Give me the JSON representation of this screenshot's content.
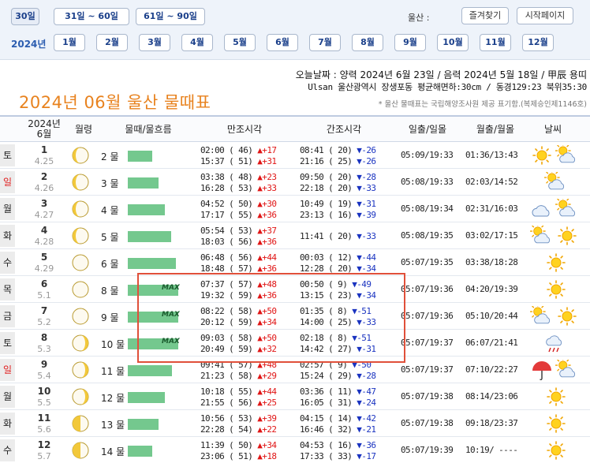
{
  "nav": {
    "range_buttons": [
      "30일",
      "31일 ~ 60일",
      "61일 ~ 90일"
    ],
    "region_label": "울산 :",
    "favorite_button": "즐겨찾기",
    "homepage_button": "시작페이지",
    "year": "2024년",
    "months": [
      "1월",
      "2월",
      "3월",
      "4월",
      "5월",
      "6월",
      "7월",
      "8월",
      "9월",
      "10월",
      "11월",
      "12월"
    ]
  },
  "info": {
    "line1": "오늘날짜 : 양력 2024년 6월 23일 / 음력 2024년 5월 18일 / 甲辰 용띠",
    "line2": "Ulsan 울산광역시 장생포동 평균해면하:30cm / 동경129:23 북위35:30",
    "title": "2024년 06월 울산 물때표",
    "note": "* 울산 물때표는 국립해양조사원 제공 표기함.(복제승인제1146호)"
  },
  "table": {
    "headers": {
      "date": "2024년\n6월",
      "moon_age": "월령",
      "tide": "물때/물흐름",
      "high": "만조시각",
      "low": "간조시각",
      "sun": "일출/일몰",
      "moonrise": "월출/월몰",
      "weather": "날씨"
    },
    "rows": [
      {
        "dow": "토",
        "red": false,
        "day": "1",
        "lunar": "4.25",
        "moon": "waning-crescent",
        "mul": "2 물",
        "bar": 0.4,
        "max": "",
        "h1": "02:00 ( 46)",
        "h1d": "▲+17",
        "h2": "15:37 ( 51)",
        "h2d": "▲+31",
        "l1": "08:41 ( 20)",
        "l1d": "▼-26",
        "l2": "21:16 ( 25)",
        "l2d": "▼-26",
        "sun": "05:09/19:33",
        "moonrise": "01:36/13:43",
        "weather": [
          "sun",
          "sun-cloud"
        ]
      },
      {
        "dow": "일",
        "red": true,
        "day": "2",
        "lunar": "4.26",
        "moon": "waning-crescent",
        "mul": "3 물",
        "bar": 0.5,
        "max": "",
        "h1": "03:38 ( 48)",
        "h1d": "▲+23",
        "h2": "16:28 ( 53)",
        "h2d": "▲+33",
        "l1": "09:50 ( 20)",
        "l1d": "▼-28",
        "l2": "22:18 ( 20)",
        "l2d": "▼-33",
        "sun": "05:08/19:33",
        "moonrise": "02:03/14:52",
        "weather": [
          "sun-cloud"
        ]
      },
      {
        "dow": "월",
        "red": false,
        "day": "3",
        "lunar": "4.27",
        "moon": "waning-crescent",
        "mul": "4 물",
        "bar": 0.6,
        "max": "",
        "h1": "04:52 ( 50)",
        "h1d": "▲+30",
        "h2": "17:17 ( 55)",
        "h2d": "▲+36",
        "l1": "10:49 ( 19)",
        "l1d": "▼-31",
        "l2": "23:13 ( 16)",
        "l2d": "▼-39",
        "sun": "05:08/19:34",
        "moonrise": "02:31/16:03",
        "weather": [
          "cloud",
          "sun-cloud"
        ]
      },
      {
        "dow": "화",
        "red": false,
        "day": "4",
        "lunar": "4.28",
        "moon": "waning-crescent",
        "mul": "5 물",
        "bar": 0.7,
        "max": "",
        "h1": "05:54 ( 53)",
        "h1d": "▲+37",
        "h2": "18:03 ( 56)",
        "h2d": "▲+36",
        "l1": "11:41 ( 20)",
        "l1d": "▼-33",
        "l2": "",
        "l2d": "",
        "sun": "05:08/19:35",
        "moonrise": "03:02/17:15",
        "weather": [
          "sun-cloud",
          "sun"
        ]
      },
      {
        "dow": "수",
        "red": false,
        "day": "5",
        "lunar": "4.29",
        "moon": "new",
        "mul": "6 물",
        "bar": 0.78,
        "max": "",
        "h1": "06:48 ( 56)",
        "h1d": "▲+44",
        "h2": "18:48 ( 57)",
        "h2d": "▲+36",
        "l1": "00:03 ( 12)",
        "l1d": "▼-44",
        "l2": "12:28 ( 20)",
        "l2d": "▼-34",
        "sun": "05:07/19:35",
        "moonrise": "03:38/18:28",
        "weather": [
          "sun"
        ]
      },
      {
        "dow": "목",
        "red": false,
        "day": "6",
        "lunar": "5.1",
        "moon": "new",
        "mul": "8 물",
        "bar": 0.82,
        "max": "MAX",
        "h1": "07:37 ( 57)",
        "h1d": "▲+48",
        "h2": "19:32 ( 59)",
        "h2d": "▲+36",
        "l1": "00:50 (  9)",
        "l1d": "▼-49",
        "l2": "13:15 ( 23)",
        "l2d": "▼-34",
        "sun": "05:07/19:36",
        "moonrise": "04:20/19:39",
        "weather": [
          "sun"
        ]
      },
      {
        "dow": "금",
        "red": false,
        "day": "7",
        "lunar": "5.2",
        "moon": "new",
        "mul": "9 물",
        "bar": 0.82,
        "max": "MAX",
        "h1": "08:22 ( 58)",
        "h1d": "▲+50",
        "h2": "20:12 ( 59)",
        "h2d": "▲+34",
        "l1": "01:35 (  8)",
        "l1d": "▼-51",
        "l2": "14:00 ( 25)",
        "l2d": "▼-33",
        "sun": "05:07/19:36",
        "moonrise": "05:10/20:44",
        "weather": [
          "sun-cloud",
          "sun"
        ]
      },
      {
        "dow": "토",
        "red": false,
        "day": "8",
        "lunar": "5.3",
        "moon": "waxing-crescent",
        "mul": "10 물",
        "bar": 0.82,
        "max": "MAX",
        "h1": "09:03 ( 58)",
        "h1d": "▲+50",
        "h2": "20:49 ( 59)",
        "h2d": "▲+32",
        "l1": "02:18 (  8)",
        "l1d": "▼-51",
        "l2": "14:42 ( 27)",
        "l2d": "▼-31",
        "sun": "05:07/19:37",
        "moonrise": "06:07/21:41",
        "weather": [
          "rain"
        ]
      },
      {
        "dow": "일",
        "red": true,
        "day": "9",
        "lunar": "5.4",
        "moon": "waxing-crescent",
        "mul": "11 물",
        "bar": 0.72,
        "max": "",
        "h1": "09:41 ( 57)",
        "h1d": "▲+48",
        "h2": "21:23 ( 58)",
        "h2d": "▲+29",
        "l1": "02:57 (  9)",
        "l1d": "▼-50",
        "l2": "15:24 ( 29)",
        "l2d": "▼-28",
        "sun": "05:07/19:37",
        "moonrise": "07:10/22:27",
        "weather": [
          "rain-umbrella",
          "sun-cloud"
        ]
      },
      {
        "dow": "월",
        "red": false,
        "day": "10",
        "lunar": "5.5",
        "moon": "waxing-crescent",
        "mul": "12 물",
        "bar": 0.6,
        "max": "",
        "h1": "10:18 ( 55)",
        "h1d": "▲+44",
        "h2": "21:55 ( 56)",
        "h2d": "▲+25",
        "l1": "03:36 ( 11)",
        "l1d": "▼-47",
        "l2": "16:05 ( 31)",
        "l2d": "▼-24",
        "sun": "05:07/19:38",
        "moonrise": "08:14/23:06",
        "weather": [
          "sun"
        ]
      },
      {
        "dow": "화",
        "red": false,
        "day": "11",
        "lunar": "5.6",
        "moon": "waxing-half",
        "mul": "13 물",
        "bar": 0.5,
        "max": "",
        "h1": "10:56 ( 53)",
        "h1d": "▲+39",
        "h2": "22:28 ( 54)",
        "h2d": "▲+22",
        "l1": "04:15 ( 14)",
        "l1d": "▼-42",
        "l2": "16:46 ( 32)",
        "l2d": "▼-21",
        "sun": "05:07/19:38",
        "moonrise": "09:18/23:37",
        "weather": [
          "sun"
        ]
      },
      {
        "dow": "수",
        "red": false,
        "day": "12",
        "lunar": "5.7",
        "moon": "waxing-half",
        "mul": "14 물",
        "bar": 0.4,
        "max": "",
        "h1": "11:39 ( 50)",
        "h1d": "▲+34",
        "h2": "23:06 ( 51)",
        "h2d": "▲+18",
        "l1": "04:53 ( 16)",
        "l1d": "▼-36",
        "l2": "17:33 ( 33)",
        "l2d": "▼-17",
        "sun": "05:07/19:39",
        "moonrise": "10:19/ ----",
        "weather": [
          "sun"
        ]
      }
    ]
  },
  "colors": {
    "accent": "#2c5db0",
    "title": "#e8821e",
    "bar": "#74c88e",
    "rise": "#e01515",
    "fall": "#1a33c0",
    "highlight": "#e0503a"
  }
}
